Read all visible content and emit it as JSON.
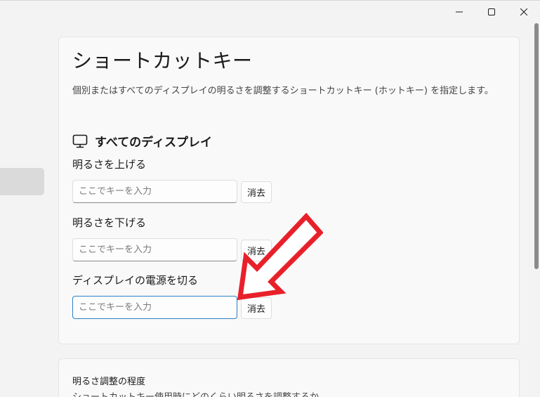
{
  "window": {
    "caption": {
      "minimize_icon": "minimize-icon",
      "maximize_icon": "maximize-icon",
      "close_icon": "close-icon"
    }
  },
  "main": {
    "title": "ショートカットキー",
    "description": "個別またはすべてのディスプレイの明るさを調整するショートカットキー (ホットキー) を指定します。",
    "section": {
      "icon": "monitor-icon",
      "title": "すべてのディスプレイ"
    },
    "shortcuts": [
      {
        "label": "明るさを上げる",
        "placeholder": "ここでキーを入力",
        "value": "",
        "clear_label": "消去"
      },
      {
        "label": "明るさを下げる",
        "placeholder": "ここでキーを入力",
        "value": "",
        "clear_label": "消去"
      },
      {
        "label": "ディスプレイの電源を切る",
        "placeholder": "ここでキーを入力",
        "value": "",
        "clear_label": "消去"
      }
    ]
  },
  "secondary": {
    "heading": "明るさ調整の程度",
    "subtext": "ショートカットキー使用時にどのくらい明るさを調整するか。"
  },
  "colors": {
    "accent": "#2b7fc4",
    "annotation_arrow": "#e8202a"
  }
}
